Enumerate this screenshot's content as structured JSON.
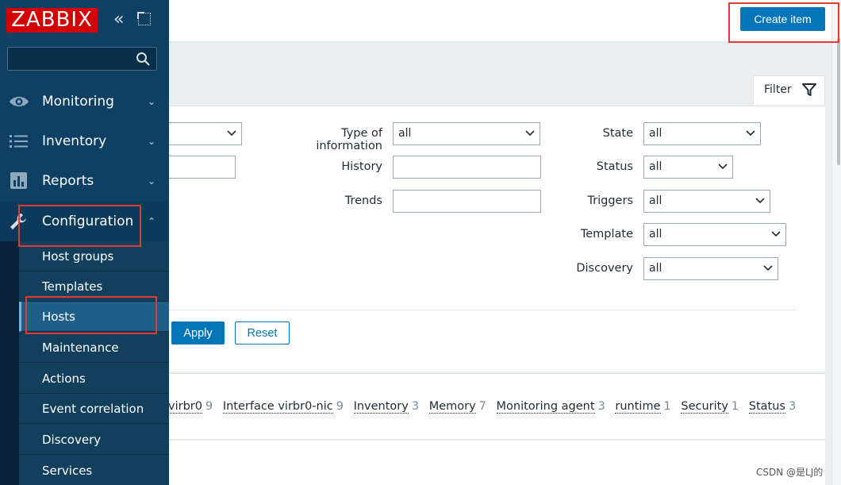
{
  "app": {
    "logo_text": "ZABBIX",
    "collapse_glyph": "«"
  },
  "sidebar": {
    "search_placeholder": "",
    "menu": [
      {
        "label": "Monitoring",
        "icon": "eye-icon",
        "arrow": "⌄"
      },
      {
        "label": "Inventory",
        "icon": "list-icon",
        "arrow": "⌄"
      },
      {
        "label": "Reports",
        "icon": "bar-chart-icon",
        "arrow": "⌄"
      },
      {
        "label": "Configuration",
        "icon": "wrench-icon",
        "arrow": "⌃"
      }
    ],
    "submenu": [
      {
        "label": "Host groups"
      },
      {
        "label": "Templates"
      },
      {
        "label": "Hosts"
      },
      {
        "label": "Maintenance"
      },
      {
        "label": "Actions"
      },
      {
        "label": "Event correlation"
      },
      {
        "label": "Discovery"
      },
      {
        "label": "Services"
      }
    ]
  },
  "header": {
    "create_item_label": "Create item"
  },
  "filter": {
    "tab_label": "Filter",
    "type_of_information": {
      "label": "Type of information",
      "value": "all"
    },
    "history": {
      "label": "History",
      "value": ""
    },
    "trends": {
      "label": "Trends",
      "value": ""
    },
    "state": {
      "label": "State",
      "value": "all"
    },
    "status": {
      "label": "Status",
      "value": "all"
    },
    "triggers": {
      "label": "Triggers",
      "value": "all"
    },
    "template": {
      "label": "Template",
      "value": "all"
    },
    "discovery": {
      "label": "Discovery",
      "value": "all"
    },
    "apply_label": "Apply",
    "reset_label": "Reset"
  },
  "tags": [
    {
      "name": "virbr0",
      "count": "9"
    },
    {
      "name": "Interface virbr0-nic",
      "count": "9"
    },
    {
      "name": "Inventory",
      "count": "3"
    },
    {
      "name": "Memory",
      "count": "7"
    },
    {
      "name": "Monitoring agent",
      "count": "3"
    },
    {
      "name": "runtime",
      "count": "1"
    },
    {
      "name": "Security",
      "count": "1"
    },
    {
      "name": "Status",
      "count": "3"
    }
  ],
  "watermark": "CSDN @是LJ的",
  "colors": {
    "sidebar_bg": "#0e4064",
    "accent": "#0275b8",
    "logo_red": "#d40000",
    "highlight_red": "#e53935"
  }
}
